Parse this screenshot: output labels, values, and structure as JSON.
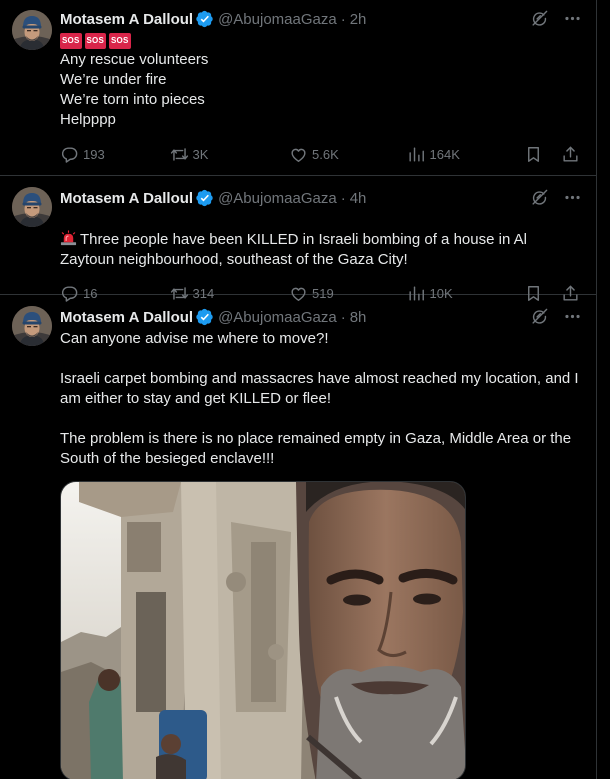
{
  "tweets": [
    {
      "name": "Motasem A Dalloul",
      "handle": "@AbujomaaGaza",
      "dot": "·",
      "time": "2h",
      "sos": [
        "SOS",
        "SOS",
        "SOS"
      ],
      "text": "Any rescue volunteers\nWe’re under fire\nWe’re torn into pieces\nHelpppp",
      "replies": "193",
      "retweets": "3K",
      "likes": "5.6K",
      "views": "164K"
    },
    {
      "name": "Motasem A Dalloul",
      "handle": "@AbujomaaGaza",
      "dot": "·",
      "time": "4h",
      "text": "Three people have been KILLED in Israeli bombing of a house in Al Zaytoun neighbourhood, southeast of the Gaza City!",
      "replies": "16",
      "retweets": "314",
      "likes": "519",
      "views": "10K"
    },
    {
      "name": "Motasem A Dalloul",
      "handle": "@AbujomaaGaza",
      "dot": "·",
      "time": "8h",
      "text": "Can anyone advise me where to move?!\n\nIsraeli carpet bombing and massacres have almost reached my location, and I am either to stay and get KILLED or flee!\n\nThe problem is there is no place remained empty in Gaza, Middle Area or the South of the besieged enclave!!!"
    }
  ],
  "icons": {
    "verified": "verified-badge-icon",
    "grok": "grok-icon",
    "more": "more-icon",
    "reply": "reply-icon",
    "retweet": "retweet-icon",
    "like": "like-icon",
    "views": "views-icon",
    "bookmark": "bookmark-icon",
    "share": "share-icon",
    "siren": "police-light-icon"
  },
  "colors": {
    "background": "#000000",
    "text": "#e7e9ea",
    "muted": "#71767b",
    "verified": "#1d9bf0",
    "sos": "#d9254a",
    "divider": "#2f3336"
  }
}
